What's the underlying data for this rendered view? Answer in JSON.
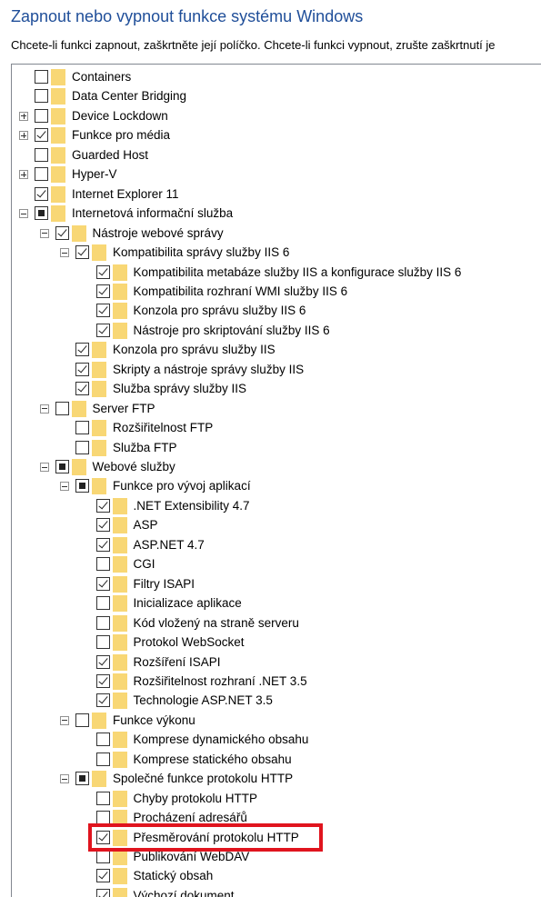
{
  "window": {
    "title": "Zapnout nebo vypnout funkce systému Windows",
    "instructions": "Chcete-li funkci zapnout, zaškrtněte její políčko. Chcete-li funkci vypnout, zrušte zaškrtnutí je"
  },
  "features": [
    {
      "level": 0,
      "expander": "none",
      "state": "unchecked",
      "label": "Containers"
    },
    {
      "level": 0,
      "expander": "none",
      "state": "unchecked",
      "label": "Data Center Bridging"
    },
    {
      "level": 0,
      "expander": "plus",
      "state": "unchecked",
      "label": "Device Lockdown"
    },
    {
      "level": 0,
      "expander": "plus",
      "state": "checked",
      "label": "Funkce pro média"
    },
    {
      "level": 0,
      "expander": "none",
      "state": "unchecked",
      "label": "Guarded Host"
    },
    {
      "level": 0,
      "expander": "plus",
      "state": "unchecked",
      "label": "Hyper-V"
    },
    {
      "level": 0,
      "expander": "none",
      "state": "checked",
      "label": "Internet Explorer 11"
    },
    {
      "level": 0,
      "expander": "minus",
      "state": "partial",
      "label": "Internetová informační služba"
    },
    {
      "level": 1,
      "expander": "minus",
      "state": "checked",
      "label": "Nástroje webové správy"
    },
    {
      "level": 2,
      "expander": "minus",
      "state": "checked",
      "label": "Kompatibilita správy služby IIS 6"
    },
    {
      "level": 3,
      "expander": "none",
      "state": "checked",
      "label": "Kompatibilita metabáze služby IIS a konfigurace služby IIS 6"
    },
    {
      "level": 3,
      "expander": "none",
      "state": "checked",
      "label": "Kompatibilita rozhraní WMI služby IIS 6"
    },
    {
      "level": 3,
      "expander": "none",
      "state": "checked",
      "label": "Konzola pro správu služby IIS 6"
    },
    {
      "level": 3,
      "expander": "none",
      "state": "checked",
      "label": "Nástroje pro skriptování služby IIS 6"
    },
    {
      "level": 2,
      "expander": "none",
      "state": "checked",
      "label": "Konzola pro správu služby IIS"
    },
    {
      "level": 2,
      "expander": "none",
      "state": "checked",
      "label": "Skripty a nástroje správy služby IIS"
    },
    {
      "level": 2,
      "expander": "none",
      "state": "checked",
      "label": "Služba správy služby IIS"
    },
    {
      "level": 1,
      "expander": "minus",
      "state": "unchecked",
      "label": "Server FTP"
    },
    {
      "level": 2,
      "expander": "none",
      "state": "unchecked",
      "label": "Rozšiřitelnost FTP"
    },
    {
      "level": 2,
      "expander": "none",
      "state": "unchecked",
      "label": "Služba FTP"
    },
    {
      "level": 1,
      "expander": "minus",
      "state": "partial",
      "label": "Webové služby"
    },
    {
      "level": 2,
      "expander": "minus",
      "state": "partial",
      "label": "Funkce pro vývoj aplikací"
    },
    {
      "level": 3,
      "expander": "none",
      "state": "checked",
      "label": ".NET Extensibility 4.7"
    },
    {
      "level": 3,
      "expander": "none",
      "state": "checked",
      "label": "ASP"
    },
    {
      "level": 3,
      "expander": "none",
      "state": "checked",
      "label": "ASP.NET 4.7"
    },
    {
      "level": 3,
      "expander": "none",
      "state": "unchecked",
      "label": "CGI"
    },
    {
      "level": 3,
      "expander": "none",
      "state": "checked",
      "label": "Filtry ISAPI"
    },
    {
      "level": 3,
      "expander": "none",
      "state": "unchecked",
      "label": "Inicializace aplikace"
    },
    {
      "level": 3,
      "expander": "none",
      "state": "unchecked",
      "label": "Kód vložený na straně serveru"
    },
    {
      "level": 3,
      "expander": "none",
      "state": "unchecked",
      "label": "Protokol WebSocket"
    },
    {
      "level": 3,
      "expander": "none",
      "state": "checked",
      "label": "Rozšíření ISAPI"
    },
    {
      "level": 3,
      "expander": "none",
      "state": "checked",
      "label": "Rozšiřitelnost rozhraní .NET 3.5"
    },
    {
      "level": 3,
      "expander": "none",
      "state": "checked",
      "label": "Technologie ASP.NET 3.5"
    },
    {
      "level": 2,
      "expander": "minus",
      "state": "unchecked",
      "label": "Funkce výkonu"
    },
    {
      "level": 3,
      "expander": "none",
      "state": "unchecked",
      "label": "Komprese dynamického obsahu"
    },
    {
      "level": 3,
      "expander": "none",
      "state": "unchecked",
      "label": "Komprese statického obsahu"
    },
    {
      "level": 2,
      "expander": "minus",
      "state": "partial",
      "label": "Společné funkce protokolu HTTP"
    },
    {
      "level": 3,
      "expander": "none",
      "state": "unchecked",
      "label": "Chyby protokolu HTTP"
    },
    {
      "level": 3,
      "expander": "none",
      "state": "unchecked",
      "label": "Procházení adresářů"
    },
    {
      "level": 3,
      "expander": "none",
      "state": "checked",
      "label": "Přesměrování protokolu HTTP",
      "highlighted": true
    },
    {
      "level": 3,
      "expander": "none",
      "state": "unchecked",
      "label": "Publikování WebDAV"
    },
    {
      "level": 3,
      "expander": "none",
      "state": "checked",
      "label": "Statický obsah"
    },
    {
      "level": 3,
      "expander": "none",
      "state": "checked",
      "label": "Výchozí dokument"
    }
  ],
  "colors": {
    "title": "#1f4e99",
    "folder": "#f8d775",
    "highlight_border": "#e0141e"
  }
}
